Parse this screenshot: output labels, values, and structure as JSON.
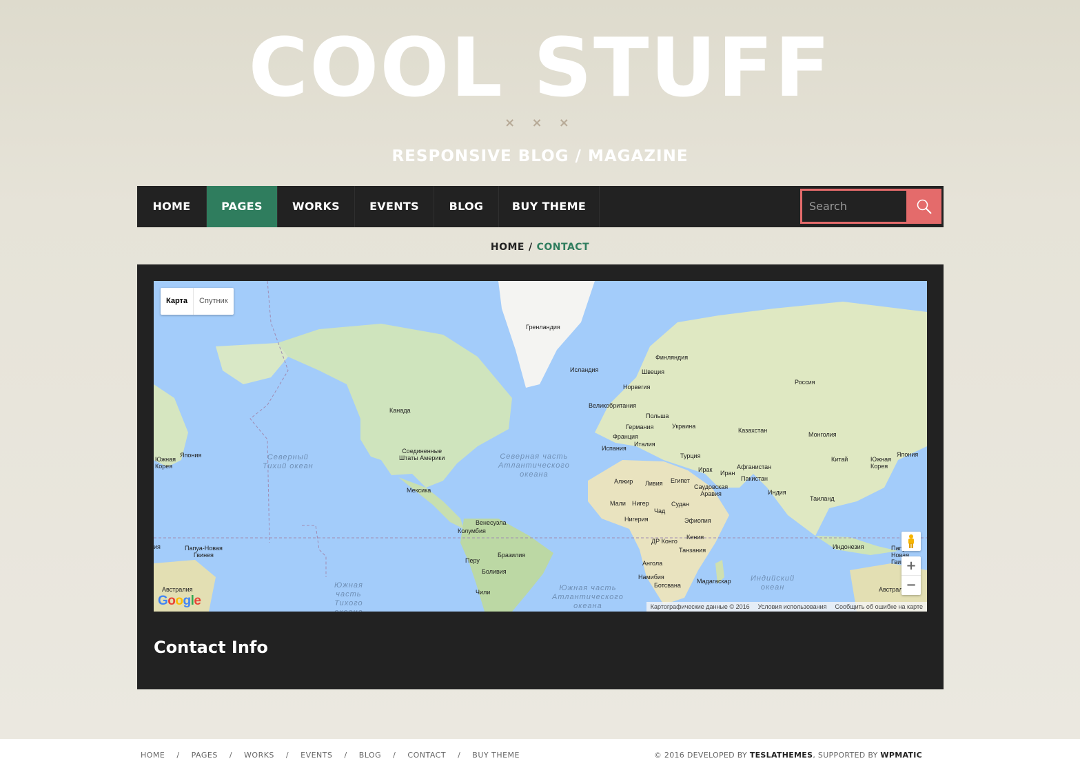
{
  "header": {
    "site_title": "COOL STUFF",
    "ornament": "× × ×",
    "tagline": "RESPONSIVE BLOG / MAGAZINE"
  },
  "nav": {
    "items": [
      {
        "label": "HOME"
      },
      {
        "label": "PAGES",
        "active": true
      },
      {
        "label": "WORKS"
      },
      {
        "label": "EVENTS"
      },
      {
        "label": "BLOG"
      },
      {
        "label": "BUY THEME"
      }
    ],
    "search_placeholder": "Search",
    "active_color": "#2f7d5e",
    "search_accent": "#e46b6b"
  },
  "breadcrumb": {
    "home": "HOME",
    "separator": "/",
    "current": "CONTACT"
  },
  "map": {
    "type_map": "Карта",
    "type_satellite": "Спутник",
    "labels": {
      "greenland": "Гренландия",
      "iceland": "Исландия",
      "finland": "Финляндия",
      "sweden": "Швеция",
      "norway": "Норвегия",
      "russia": "Россия",
      "uk": "Великобритания",
      "poland": "Польша",
      "germany": "Германия",
      "ukraine": "Украина",
      "france": "Франция",
      "kazakhstan": "Казахстан",
      "mongolia": "Монголия",
      "spain": "Испания",
      "italy": "Италия",
      "turkey": "Турция",
      "china": "Китай",
      "south_korea_e": "Южная\nКорея",
      "japan_e": "Япония",
      "iraq": "Ирак",
      "iran": "Иран",
      "afghanistan": "Афганистан",
      "algeria": "Алжир",
      "libya": "Ливия",
      "egypt": "Египет",
      "saudi": "Саудовская\nАравия",
      "pakistan": "Пакистан",
      "india": "Индия",
      "thailand": "Таиланд",
      "mali": "Мали",
      "niger": "Нигер",
      "chad": "Чад",
      "sudan": "Судан",
      "nigeria": "Нигерия",
      "ethiopia": "Эфиопия",
      "drc": "ДР Конго",
      "kenya": "Кения",
      "tanzania": "Танзания",
      "angola": "Ангола",
      "namibia": "Намибия",
      "botswana": "Ботсвана",
      "madagascar": "Мадагаскар",
      "indonesia": "Индонезия",
      "png_e": "Папуа-\nНовая\nГвинея",
      "australia_e": "Австралия",
      "canada": "Канада",
      "usa": "Соединенные\nШтаты Америки",
      "mexico": "Мексика",
      "venezuela": "Венесуэла",
      "colombia": "Колумбия",
      "brazil": "Бразилия",
      "peru": "Перу",
      "bolivia": "Боливия",
      "chile": "Чили",
      "south_korea_w": "Южная\nКорея",
      "japan_w": "Япония",
      "png_w": "Папуа-Новая\nГвинея",
      "australia_w": "Австралия",
      "ja_edge": "ия"
    },
    "oceans": {
      "north_pacific": "Северный\nТихий океан",
      "north_atlantic": "Северная часть\nАтлантического\nокеана",
      "south_pacific": "Южная\nчасть\nТихого\nокеана",
      "south_atlantic": "Южная часть\nАтлантического\nокеана",
      "indian": "Индийский\nокеан"
    },
    "google": "Google",
    "attribution": {
      "data": "Картографические данные © 2016",
      "terms": "Условия использования",
      "report": "Сообщить об ошибке на карте"
    },
    "zoom_in": "+",
    "zoom_out": "−"
  },
  "content": {
    "contact_title": "Contact Info"
  },
  "footer": {
    "links": [
      "HOME",
      "PAGES",
      "WORKS",
      "EVENTS",
      "BLOG",
      "CONTACT",
      "BUY THEME"
    ],
    "separator": "/",
    "copyright_prefix": "© 2016 DEVELOPED BY ",
    "developer": "TESLATHEMES",
    "supported_prefix": ", SUPPORTED BY ",
    "supporter": "WPMATIC"
  }
}
